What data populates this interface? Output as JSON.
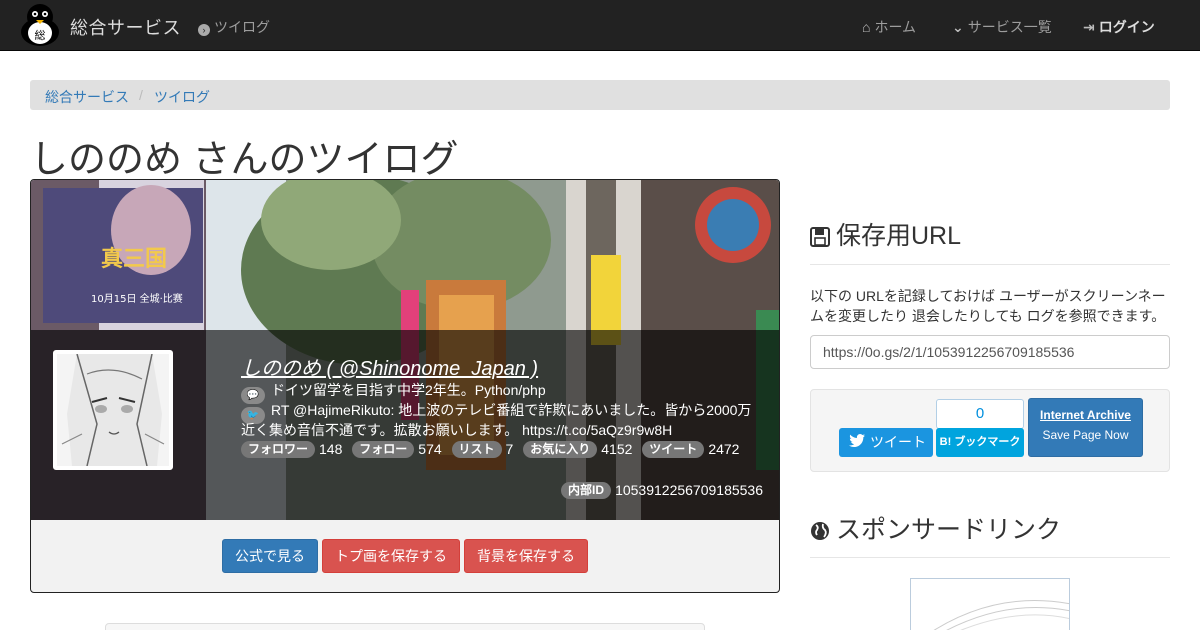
{
  "navbar": {
    "brand": "総合サービス",
    "current": "ツイログ",
    "home": "ホーム",
    "services": "サービス一覧",
    "login": "ログイン"
  },
  "breadcrumb": [
    "総合サービス",
    "ツイログ"
  ],
  "page_title": "しののめ さんのツイログ",
  "profile": {
    "display_name": "しののめ ( @Shinonome_Japan )",
    "bio": "ドイツ留学を目指す中学2年生。Python/php",
    "latest_tweet_line1": "RT @HajimeRikuto: 地上波のテレビ番組で詐欺にあいました。皆から2000万",
    "latest_tweet_line2": "近く集め音信不通です。拡散お願いします。 https://t.co/5aQz9r9w8H",
    "stats": [
      {
        "label": "フォロワー",
        "value": "148"
      },
      {
        "label": "フォロー",
        "value": "574"
      },
      {
        "label": "リスト",
        "value": "7"
      },
      {
        "label": "お気に入り",
        "value": "4152"
      },
      {
        "label": "ツイート",
        "value": "2472"
      }
    ],
    "internal_id_label": "内部ID",
    "internal_id": "1053912256709185536",
    "banner_sign_text": "真三国",
    "banner_sign_sub": "10月15日 全城·比赛"
  },
  "actions": {
    "official": "公式で見る",
    "save_icon": "トプ画を保存する",
    "save_banner": "背景を保存する"
  },
  "sidebar": {
    "save_url_title": "保存用URL",
    "save_url_desc": "以下の URLを記録しておけば ユーザーがスクリーンネームを変更したり 退会したりしても ログを参照できます。",
    "save_url_value": "https://0o.gs/2/1/1053912256709185536",
    "tweet_button": "ツイート",
    "hatena_count": "0",
    "hatena_button": "B! ブックマーク",
    "archive_title": "Internet Archive",
    "archive_sub": "Save Page Now",
    "sponsored_title": "スポンサードリンク"
  },
  "colors": {
    "navbar_bg": "#222222",
    "link": "#337ab7",
    "primary": "#337ab7",
    "danger": "#d9534f",
    "twitter": "#1b95e0",
    "hatena": "#00a4de"
  }
}
